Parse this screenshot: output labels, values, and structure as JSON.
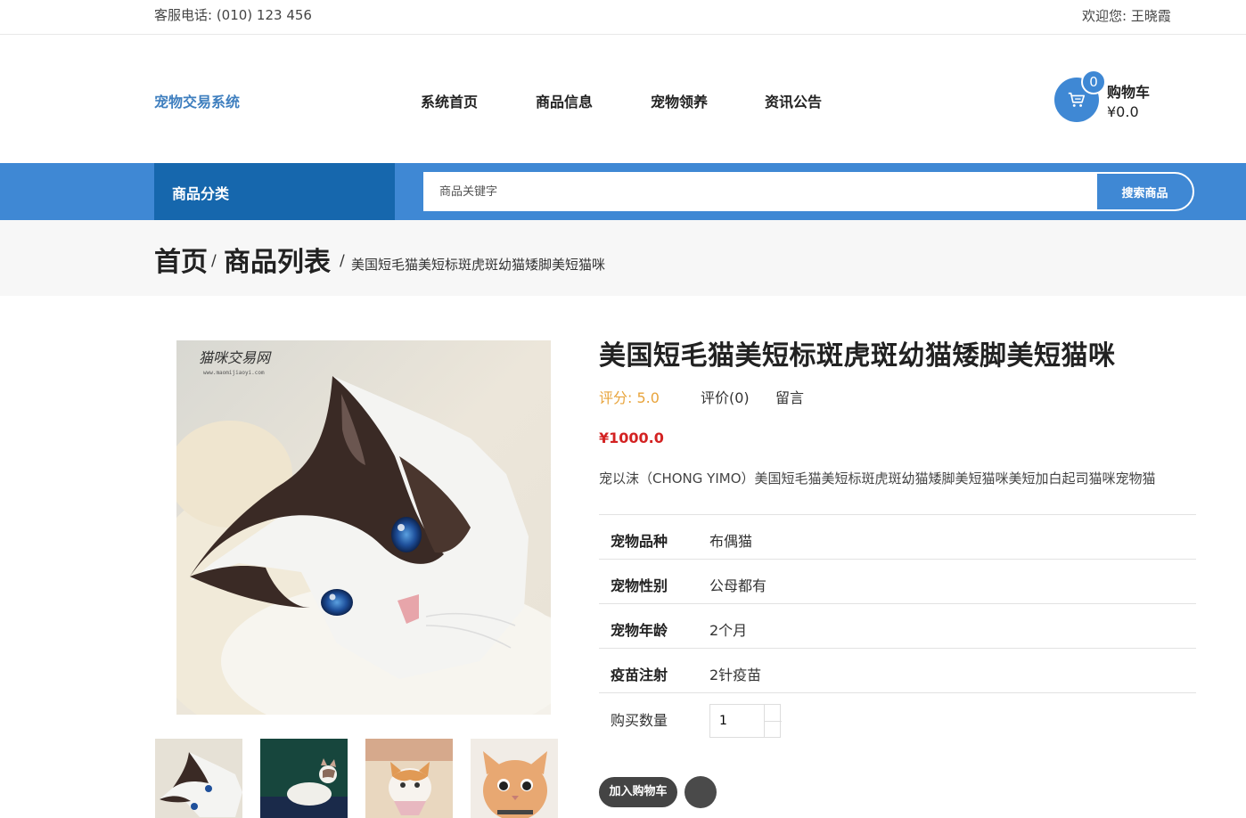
{
  "topbar": {
    "phone": "客服电话: (010) 123 456",
    "welcome": "欢迎您: 王晓霞"
  },
  "header": {
    "logo": "宠物交易系统",
    "nav": [
      "系统首页",
      "商品信息",
      "宠物领养",
      "资讯公告"
    ],
    "cart": {
      "count": "0",
      "label": "购物车",
      "total": "¥0.0"
    }
  },
  "catbar": {
    "category_label": "商品分类",
    "search_placeholder": "商品关键字",
    "search_button": "搜索商品"
  },
  "breadcrumb": {
    "home": "首页",
    "list": "商品列表",
    "sep": "/",
    "current": "美国短毛猫美短标斑虎斑幼猫矮脚美短猫咪"
  },
  "product": {
    "title": "美国短毛猫美短标斑虎斑幼猫矮脚美短猫咪",
    "rating": "评分: 5.0",
    "reviews": "评价(0)",
    "message": "留言",
    "price": "¥1000.0",
    "description": "宠以沫（CHONG YIMO）美国短毛猫美短标斑虎斑幼猫矮脚美短猫咪美短加白起司猫咪宠物猫",
    "attributes": [
      {
        "key": "宠物品种",
        "value": "布偶猫"
      },
      {
        "key": "宠物性别",
        "value": "公母都有"
      },
      {
        "key": "宠物年龄",
        "value": "2个月"
      },
      {
        "key": "疫苗注射",
        "value": "2针疫苗"
      }
    ],
    "quantity_label": "购买数量",
    "quantity": "1",
    "add_to_cart": "加入购物车",
    "image_watermark": "猫咪交易网",
    "image_watermark_url": "www.maomijiaoyi.com"
  },
  "colors": {
    "primary": "#3f88d4",
    "dark_blue": "#1667ad",
    "price": "#d32222",
    "rating": "#e8a43c"
  },
  "icons": {
    "cart": "cart-icon",
    "favorite": "favorite-icon"
  }
}
